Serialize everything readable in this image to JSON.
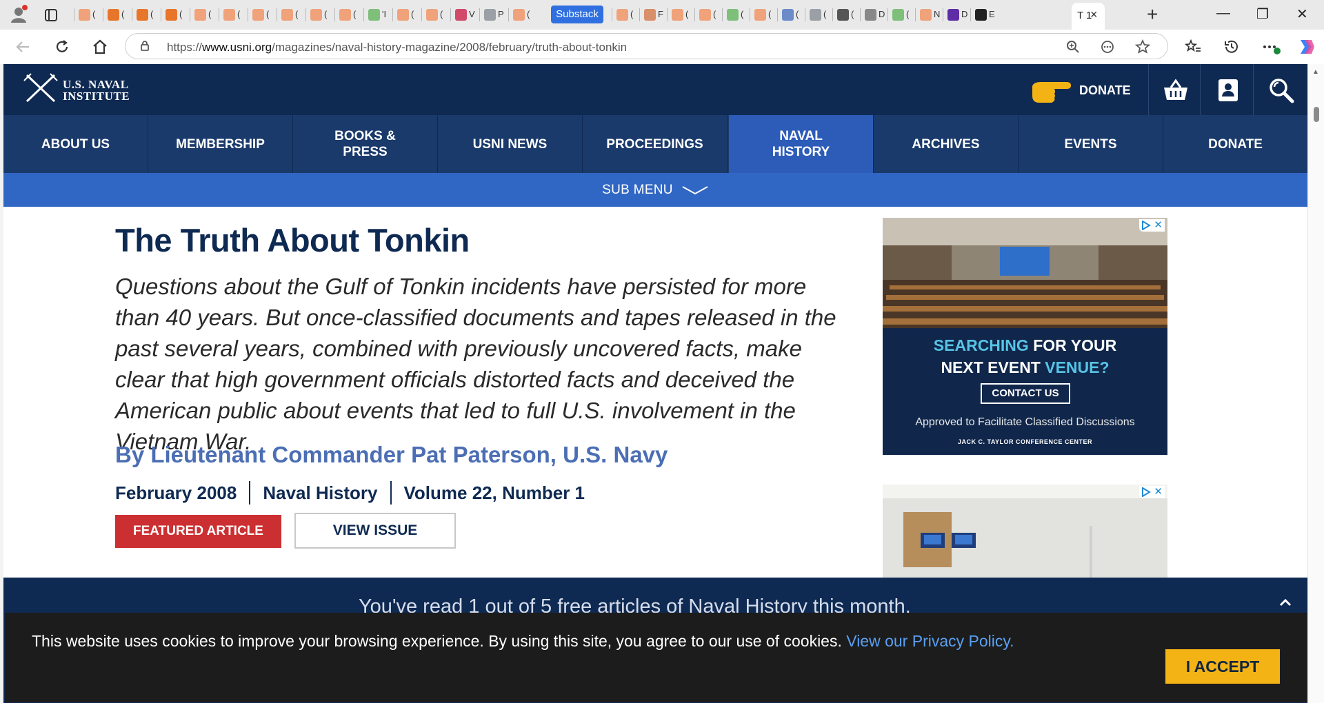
{
  "browser": {
    "tab_fragments": [
      "(",
      "(",
      "(",
      "(",
      "(",
      "(",
      "(",
      "(",
      "(",
      "(",
      "'I",
      "(",
      "(",
      "V",
      "P",
      "(",
      "(",
      "F",
      "(",
      "(",
      "(",
      "(",
      "(",
      "(",
      "(",
      "D",
      "(",
      "N",
      "D",
      "E"
    ],
    "substack_tab": "Substack",
    "active_tab": {
      "label": "T 1",
      "close": "×"
    },
    "new_tab": "+",
    "url": {
      "scheme": "https://",
      "host": "www.usni.org",
      "path": "/magazines/naval-history-magazine/2008/february/truth-about-tonkin"
    },
    "window_controls": [
      "—",
      "❐",
      "✕"
    ]
  },
  "site": {
    "logo_line1": "U.S. NAVAL",
    "logo_line2": "INSTITUTE",
    "header_donate": "DONATE",
    "nav": [
      {
        "label": "ABOUT US",
        "active": false
      },
      {
        "label": "MEMBERSHIP",
        "active": false
      },
      {
        "label": "BOOKS & PRESS",
        "active": false
      },
      {
        "label": "USNI NEWS",
        "active": false
      },
      {
        "label": "PROCEEDINGS",
        "active": false
      },
      {
        "label": "NAVAL HISTORY",
        "active": true
      },
      {
        "label": "ARCHIVES",
        "active": false
      },
      {
        "label": "EVENTS",
        "active": false
      },
      {
        "label": "DONATE",
        "active": false
      }
    ],
    "submenu": "SUB MENU"
  },
  "article": {
    "title": "The Truth About Tonkin",
    "dek": "Questions about the Gulf of Tonkin incidents have persisted for more than 40 years. But once-classified documents and tapes released in the past several years, combined with previously uncovered facts, make clear that high government officials distorted facts and deceived the American public about events that led to full U.S. involvement in the Vietnam War.",
    "byline": "By Lieutenant Commander Pat Paterson, U.S. Navy",
    "meta": [
      "February 2008",
      "Naval History",
      "Volume 22, Number 1"
    ],
    "featured_button": "FEATURED ARTICLE",
    "view_issue_button": "VIEW ISSUE"
  },
  "ad1": {
    "headline1_a": "SEARCHING",
    "headline1_b": "FOR YOUR",
    "headline2_a": "NEXT EVENT",
    "headline2_b": "VENUE?",
    "cta": "CONTACT US",
    "sub": "Approved to Facilitate Classified Discussions",
    "foot": "JACK C. TAYLOR CONFERENCE CENTER"
  },
  "paywall": {
    "text": "You've read 1 out of 5 free articles of Naval History this month."
  },
  "cookie": {
    "text": "This website uses cookies to improve your browsing experience. By using this site, you agree to our use of cookies.",
    "link": "View our Privacy Policy.",
    "accept": "I ACCEPT"
  },
  "colors": {
    "header_bg": "#0f2a52",
    "nav_bg": "#1a3a6b",
    "nav_active": "#2d5cb8",
    "submenu_bg": "#3167c4",
    "title": "#0f2a52",
    "byline": "#4b6eb4",
    "featured_red": "#cc2f31",
    "accept_gold": "#f4b315",
    "link_blue": "#5aa0f3"
  }
}
